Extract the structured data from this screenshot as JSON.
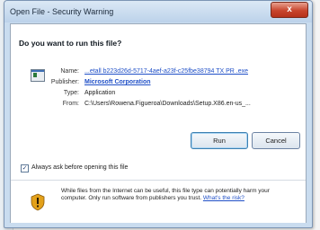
{
  "window": {
    "title": "Open File - Security Warning",
    "close_glyph": "x"
  },
  "prompt": {
    "question": "Do you want to run this file?"
  },
  "file_info": {
    "name_label": "Name:",
    "name_value": "...etall b223d26d-5717-4aef-a23f-c25fbe38794 TX PR .exe",
    "publisher_label": "Publisher:",
    "publisher_value": "Microsoft Corporation",
    "type_label": "Type:",
    "type_value": "Application",
    "from_label": "From:",
    "from_value": "C:\\Users\\Rowena.Figueroa\\Downloads\\Setup.X86.en-us_..."
  },
  "buttons": {
    "run": "Run",
    "cancel": "Cancel"
  },
  "checkbox": {
    "label": "Always ask before opening this file",
    "checked": true,
    "mark": "✓"
  },
  "warning": {
    "text": "While files from the Internet can be useful, this file type can potentially harm your computer. Only run software from publishers you trust.",
    "link": "What's the risk?"
  },
  "icons": {
    "file": "application-file-icon",
    "shield": "security-shield-icon"
  },
  "colors": {
    "link": "#1f4fc7",
    "titlebar": "#bcd2ea",
    "close": "#c8452d"
  }
}
